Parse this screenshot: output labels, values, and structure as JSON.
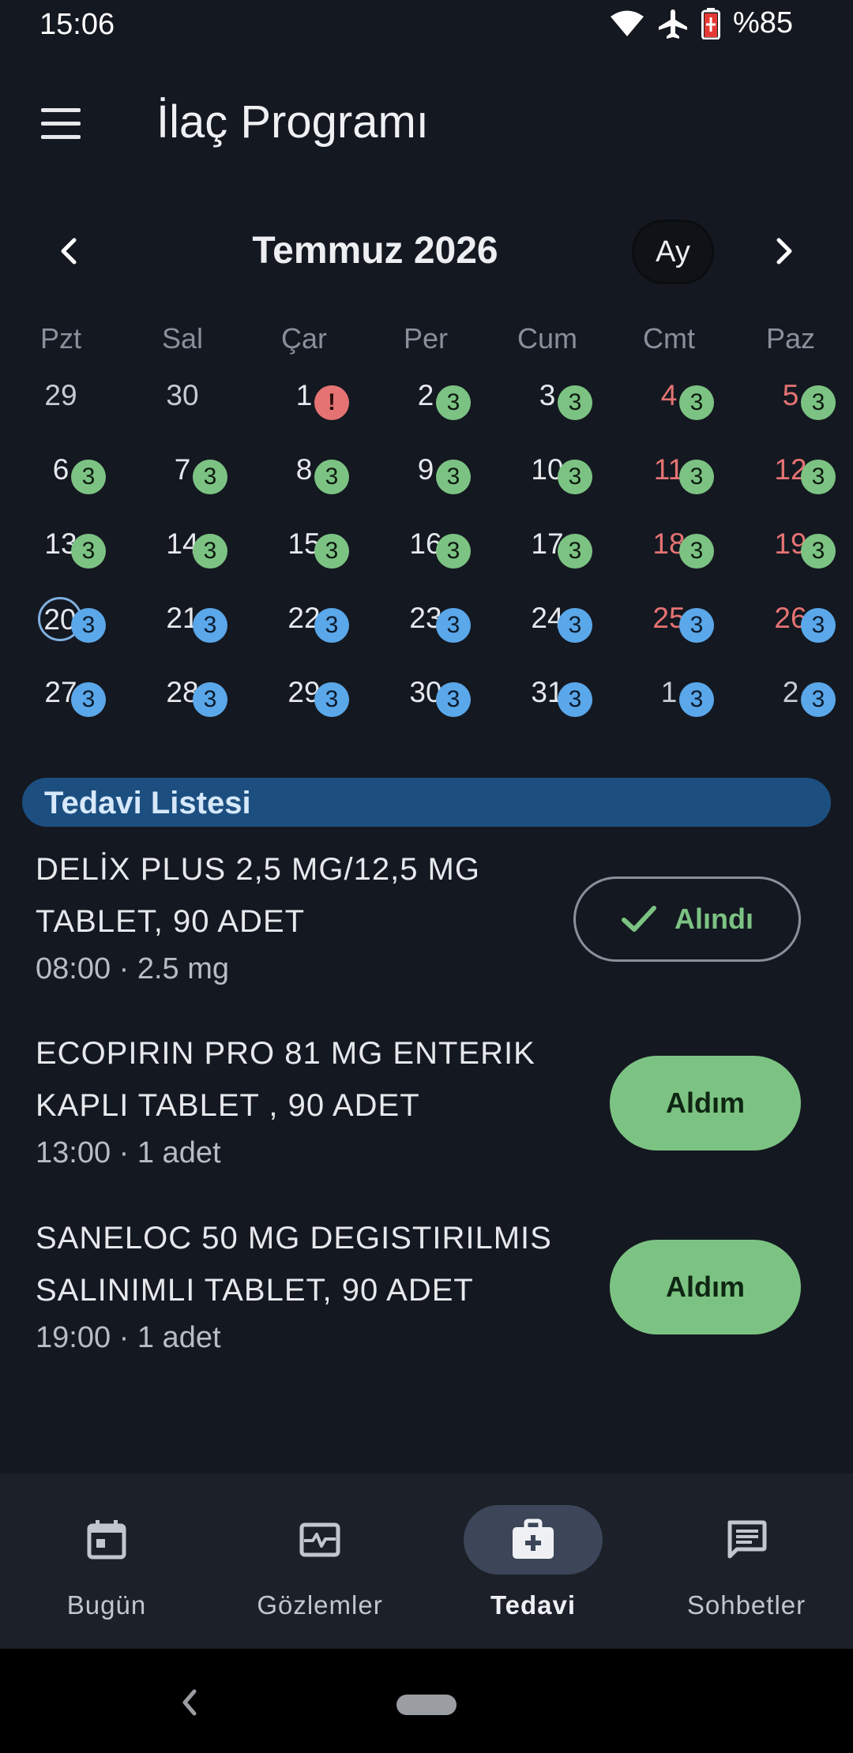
{
  "status_bar": {
    "time": "15:06",
    "battery": "%85",
    "icons": [
      "wifi-icon",
      "airplane-icon",
      "battery-icon"
    ]
  },
  "app_bar": {
    "title": "İlaç Programı",
    "menu_icon": "menu-icon"
  },
  "calendar": {
    "month_title": "Temmuz 2026",
    "view_button": "Ay",
    "weekdays": [
      "Pzt",
      "Sal",
      "Çar",
      "Per",
      "Cum",
      "Cmt",
      "Paz"
    ],
    "today": "20",
    "weeks": [
      [
        {
          "day": "29",
          "badge": "",
          "status": "none",
          "outside": true
        },
        {
          "day": "30",
          "badge": "",
          "status": "none",
          "outside": true
        },
        {
          "day": "1",
          "badge": "!",
          "status": "missed"
        },
        {
          "day": "2",
          "badge": "3",
          "status": "done"
        },
        {
          "day": "3",
          "badge": "3",
          "status": "done"
        },
        {
          "day": "4",
          "badge": "3",
          "status": "done",
          "weekend": true
        },
        {
          "day": "5",
          "badge": "3",
          "status": "done",
          "weekend": true
        }
      ],
      [
        {
          "day": "6",
          "badge": "3",
          "status": "done"
        },
        {
          "day": "7",
          "badge": "3",
          "status": "done"
        },
        {
          "day": "8",
          "badge": "3",
          "status": "done"
        },
        {
          "day": "9",
          "badge": "3",
          "status": "done"
        },
        {
          "day": "10",
          "badge": "3",
          "status": "done"
        },
        {
          "day": "11",
          "badge": "3",
          "status": "done",
          "weekend": true
        },
        {
          "day": "12",
          "badge": "3",
          "status": "done",
          "weekend": true
        }
      ],
      [
        {
          "day": "13",
          "badge": "3",
          "status": "done"
        },
        {
          "day": "14",
          "badge": "3",
          "status": "done"
        },
        {
          "day": "15",
          "badge": "3",
          "status": "done"
        },
        {
          "day": "16",
          "badge": "3",
          "status": "done"
        },
        {
          "day": "17",
          "badge": "3",
          "status": "done"
        },
        {
          "day": "18",
          "badge": "3",
          "status": "done",
          "weekend": true
        },
        {
          "day": "19",
          "badge": "3",
          "status": "done",
          "weekend": true
        }
      ],
      [
        {
          "day": "20",
          "badge": "3",
          "status": "planned",
          "today": true
        },
        {
          "day": "21",
          "badge": "3",
          "status": "planned"
        },
        {
          "day": "22",
          "badge": "3",
          "status": "planned"
        },
        {
          "day": "23",
          "badge": "3",
          "status": "planned"
        },
        {
          "day": "24",
          "badge": "3",
          "status": "planned"
        },
        {
          "day": "25",
          "badge": "3",
          "status": "planned",
          "weekend": true
        },
        {
          "day": "26",
          "badge": "3",
          "status": "planned",
          "weekend": true
        }
      ],
      [
        {
          "day": "27",
          "badge": "3",
          "status": "planned"
        },
        {
          "day": "28",
          "badge": "3",
          "status": "planned"
        },
        {
          "day": "29",
          "badge": "3",
          "status": "planned"
        },
        {
          "day": "30",
          "badge": "3",
          "status": "planned"
        },
        {
          "day": "31",
          "badge": "3",
          "status": "planned"
        },
        {
          "day": "1",
          "badge": "3",
          "status": "planned",
          "outside": true
        },
        {
          "day": "2",
          "badge": "3",
          "status": "planned",
          "outside": true
        }
      ]
    ],
    "colors": {
      "done": "#7cc383",
      "planned": "#5aa7ea",
      "missed": "#e57373",
      "weekend_text": "#e57373"
    }
  },
  "treatment": {
    "section_title": "Tedavi Listesi",
    "items": [
      {
        "name": "DELİX PLUS 2,5 MG/12,5 MG TABLET, 90 ADET",
        "detail": "08:00 · 2.5 mg",
        "button": "Alındı",
        "state": "taken"
      },
      {
        "name": "ECOPIRIN PRO 81 MG  ENTERIK KAPLI TABLET , 90 ADET",
        "detail": "13:00 · 1 adet",
        "button": "Aldım",
        "state": "pending"
      },
      {
        "name": "SANELOC 50 MG DEGISTIRILMIS SALINIMLI TABLET, 90 ADET",
        "detail": "19:00 · 1 adet",
        "button": "Aldım",
        "state": "pending"
      }
    ]
  },
  "bottom_nav": {
    "items": [
      {
        "label": "Bugün",
        "icon": "calendar-today-icon",
        "active": false
      },
      {
        "label": "Gözlemler",
        "icon": "vitals-monitor-icon",
        "active": false
      },
      {
        "label": "Tedavi",
        "icon": "medical-kit-icon",
        "active": true
      },
      {
        "label": "Sohbetler",
        "icon": "chat-icon",
        "active": false
      }
    ]
  }
}
